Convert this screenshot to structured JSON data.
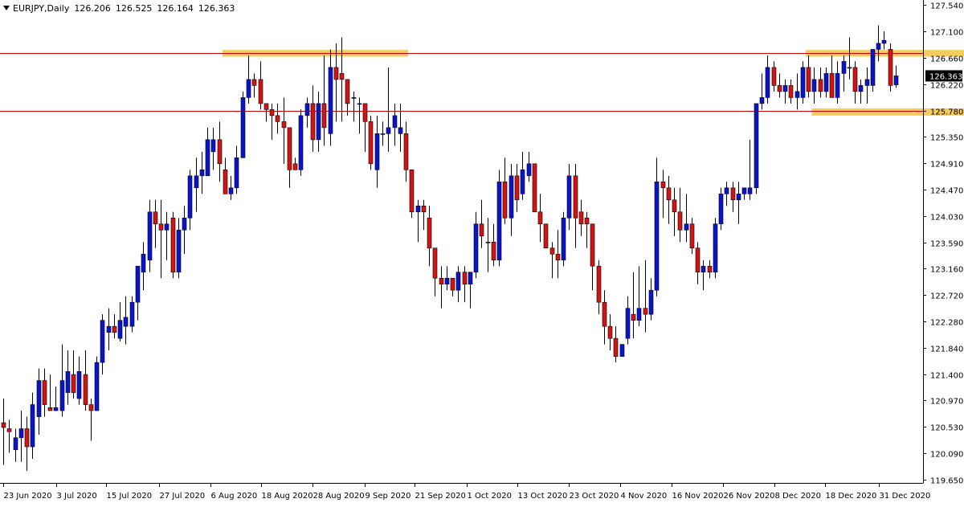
{
  "header": {
    "symbol": "EURJPY,Daily",
    "open": "126.206",
    "high": "126.525",
    "low": "126.164",
    "close": "126.363"
  },
  "current_price_label": "126.363",
  "colors": {
    "bull": "#0a14c8",
    "bear": "#d21414",
    "wick": "#000000",
    "level_line": "#cc0000",
    "zone": "#f3c242",
    "price_badge_bg": "#000000",
    "price_badge_text": "#ffffff"
  },
  "chart_data": {
    "type": "candlestick",
    "title": "",
    "y_ticks": [
      "127.540",
      "127.100",
      "126.660",
      "126.220",
      "125.780",
      "125.350",
      "124.910",
      "124.470",
      "124.030",
      "123.590",
      "123.160",
      "122.720",
      "122.280",
      "121.840",
      "121.400",
      "120.970",
      "120.530",
      "120.090",
      "119.650"
    ],
    "x_ticks": [
      "23 Jun 2020",
      "3 Jul 2020",
      "15 Jul 2020",
      "27 Jul 2020",
      "6 Aug 2020",
      "18 Aug 2020",
      "28 Aug 2020",
      "9 Sep 2020",
      "21 Sep 2020",
      "1 Oct 2020",
      "13 Oct 2020",
      "23 Oct 2020",
      "4 Nov 2020",
      "16 Nov 2020",
      "26 Nov 2020",
      "8 Dec 2020",
      "18 Dec 2020",
      "31 Dec 2020"
    ],
    "ylim": [
      119.6,
      127.62
    ],
    "levels": [
      126.74,
      125.78
    ],
    "zones": [
      {
        "from_bar": 38,
        "to_bar": 69,
        "low": 126.68,
        "high": 126.79
      },
      {
        "from_bar": 138,
        "to_bar": 167,
        "low": 126.68,
        "high": 126.79
      },
      {
        "from_bar": 139,
        "to_bar": 167,
        "low": 125.7,
        "high": 125.82
      }
    ],
    "candles": [
      {
        "o": 120.6,
        "h": 121.0,
        "l": 119.9,
        "c": 120.52
      },
      {
        "o": 120.5,
        "h": 120.65,
        "l": 120.1,
        "c": 120.45
      },
      {
        "o": 120.15,
        "h": 120.5,
        "l": 119.95,
        "c": 120.35
      },
      {
        "o": 120.35,
        "h": 120.8,
        "l": 119.95,
        "c": 120.5
      },
      {
        "o": 120.5,
        "h": 120.7,
        "l": 119.8,
        "c": 120.2
      },
      {
        "o": 120.2,
        "h": 121.1,
        "l": 120.0,
        "c": 120.9
      },
      {
        "o": 120.7,
        "h": 121.5,
        "l": 120.4,
        "c": 121.3
      },
      {
        "o": 121.3,
        "h": 121.5,
        "l": 120.7,
        "c": 120.9
      },
      {
        "o": 120.85,
        "h": 121.4,
        "l": 120.8,
        "c": 120.8
      },
      {
        "o": 120.8,
        "h": 121.2,
        "l": 120.8,
        "c": 120.85
      },
      {
        "o": 120.8,
        "h": 121.9,
        "l": 120.7,
        "c": 121.3
      },
      {
        "o": 121.1,
        "h": 121.8,
        "l": 120.9,
        "c": 121.45
      },
      {
        "o": 121.4,
        "h": 121.8,
        "l": 121.0,
        "c": 121.1
      },
      {
        "o": 121.0,
        "h": 121.7,
        "l": 120.9,
        "c": 121.45
      },
      {
        "o": 121.4,
        "h": 121.8,
        "l": 120.8,
        "c": 120.9
      },
      {
        "o": 120.9,
        "h": 121.0,
        "l": 120.3,
        "c": 120.8
      },
      {
        "o": 120.8,
        "h": 121.7,
        "l": 120.8,
        "c": 121.6
      },
      {
        "o": 121.6,
        "h": 122.4,
        "l": 121.4,
        "c": 122.3
      },
      {
        "o": 122.1,
        "h": 122.5,
        "l": 121.8,
        "c": 122.2
      },
      {
        "o": 122.2,
        "h": 122.4,
        "l": 122.0,
        "c": 122.1
      },
      {
        "o": 122.0,
        "h": 122.6,
        "l": 121.95,
        "c": 122.3
      },
      {
        "o": 122.2,
        "h": 122.7,
        "l": 121.9,
        "c": 122.35
      },
      {
        "o": 122.2,
        "h": 122.7,
        "l": 122.1,
        "c": 122.6
      },
      {
        "o": 122.6,
        "h": 123.2,
        "l": 122.3,
        "c": 123.2
      },
      {
        "o": 123.1,
        "h": 123.6,
        "l": 122.8,
        "c": 123.4
      },
      {
        "o": 123.3,
        "h": 124.3,
        "l": 123.1,
        "c": 124.1
      },
      {
        "o": 124.1,
        "h": 124.3,
        "l": 123.5,
        "c": 123.9
      },
      {
        "o": 123.9,
        "h": 124.3,
        "l": 123.0,
        "c": 123.8
      },
      {
        "o": 123.8,
        "h": 124.1,
        "l": 123.3,
        "c": 123.9
      },
      {
        "o": 124.0,
        "h": 124.1,
        "l": 123.0,
        "c": 123.1
      },
      {
        "o": 123.1,
        "h": 124.0,
        "l": 123.0,
        "c": 123.8
      },
      {
        "o": 123.8,
        "h": 124.2,
        "l": 123.4,
        "c": 124.0
      },
      {
        "o": 124.0,
        "h": 124.8,
        "l": 123.8,
        "c": 124.7
      },
      {
        "o": 124.5,
        "h": 125.0,
        "l": 124.1,
        "c": 124.7
      },
      {
        "o": 124.7,
        "h": 125.1,
        "l": 124.4,
        "c": 124.8
      },
      {
        "o": 124.7,
        "h": 125.5,
        "l": 124.7,
        "c": 125.3
      },
      {
        "o": 125.1,
        "h": 125.5,
        "l": 124.8,
        "c": 125.3
      },
      {
        "o": 125.3,
        "h": 125.6,
        "l": 124.6,
        "c": 124.9
      },
      {
        "o": 124.8,
        "h": 125.0,
        "l": 124.5,
        "c": 124.4
      },
      {
        "o": 124.4,
        "h": 124.7,
        "l": 124.3,
        "c": 124.5
      },
      {
        "o": 124.5,
        "h": 125.2,
        "l": 124.4,
        "c": 125.0
      },
      {
        "o": 125.0,
        "h": 126.1,
        "l": 125.0,
        "c": 126.0
      },
      {
        "o": 126.0,
        "h": 126.7,
        "l": 125.9,
        "c": 126.3
      },
      {
        "o": 126.3,
        "h": 126.4,
        "l": 126.0,
        "c": 126.2
      },
      {
        "o": 126.3,
        "h": 126.6,
        "l": 125.8,
        "c": 125.9
      },
      {
        "o": 125.9,
        "h": 125.9,
        "l": 125.6,
        "c": 125.8
      },
      {
        "o": 125.8,
        "h": 125.9,
        "l": 125.3,
        "c": 125.7
      },
      {
        "o": 125.7,
        "h": 125.9,
        "l": 125.4,
        "c": 125.6
      },
      {
        "o": 125.6,
        "h": 126.0,
        "l": 124.9,
        "c": 125.5
      },
      {
        "o": 125.5,
        "h": 125.5,
        "l": 124.5,
        "c": 124.8
      },
      {
        "o": 124.9,
        "h": 125.0,
        "l": 124.8,
        "c": 124.8
      },
      {
        "o": 124.8,
        "h": 125.8,
        "l": 124.7,
        "c": 125.7
      },
      {
        "o": 125.7,
        "h": 126.0,
        "l": 125.5,
        "c": 125.9
      },
      {
        "o": 125.9,
        "h": 126.2,
        "l": 125.1,
        "c": 125.3
      },
      {
        "o": 125.3,
        "h": 126.1,
        "l": 125.1,
        "c": 125.9
      },
      {
        "o": 125.9,
        "h": 126.7,
        "l": 125.2,
        "c": 125.5
      },
      {
        "o": 125.4,
        "h": 126.8,
        "l": 125.2,
        "c": 126.5
      },
      {
        "o": 126.5,
        "h": 126.9,
        "l": 125.6,
        "c": 126.3
      },
      {
        "o": 126.4,
        "h": 127.0,
        "l": 125.6,
        "c": 126.3
      },
      {
        "o": 126.3,
        "h": 126.3,
        "l": 125.7,
        "c": 125.9
      },
      {
        "o": 126.0,
        "h": 126.1,
        "l": 125.6,
        "c": 126.0
      },
      {
        "o": 125.9,
        "h": 126.0,
        "l": 125.4,
        "c": 125.9
      },
      {
        "o": 125.9,
        "h": 125.9,
        "l": 125.1,
        "c": 125.6
      },
      {
        "o": 125.6,
        "h": 125.7,
        "l": 124.8,
        "c": 124.9
      },
      {
        "o": 124.8,
        "h": 125.7,
        "l": 124.5,
        "c": 125.4
      },
      {
        "o": 125.4,
        "h": 125.6,
        "l": 125.2,
        "c": 125.4
      },
      {
        "o": 125.4,
        "h": 126.5,
        "l": 125.1,
        "c": 125.5
      },
      {
        "o": 125.5,
        "h": 125.9,
        "l": 125.2,
        "c": 125.7
      },
      {
        "o": 125.4,
        "h": 125.9,
        "l": 125.1,
        "c": 125.5
      },
      {
        "o": 125.4,
        "h": 125.6,
        "l": 124.6,
        "c": 124.8
      },
      {
        "o": 124.8,
        "h": 124.8,
        "l": 124.0,
        "c": 124.1
      },
      {
        "o": 124.1,
        "h": 124.3,
        "l": 123.6,
        "c": 124.2
      },
      {
        "o": 124.2,
        "h": 124.3,
        "l": 123.8,
        "c": 124.1
      },
      {
        "o": 124.0,
        "h": 124.2,
        "l": 123.2,
        "c": 123.5
      },
      {
        "o": 123.5,
        "h": 123.5,
        "l": 122.7,
        "c": 123.0
      },
      {
        "o": 123.0,
        "h": 123.2,
        "l": 122.5,
        "c": 122.9
      },
      {
        "o": 122.9,
        "h": 123.2,
        "l": 122.8,
        "c": 123.0
      },
      {
        "o": 123.0,
        "h": 123.0,
        "l": 122.7,
        "c": 122.8
      },
      {
        "o": 122.8,
        "h": 123.2,
        "l": 122.6,
        "c": 123.1
      },
      {
        "o": 123.1,
        "h": 123.2,
        "l": 122.6,
        "c": 122.9
      },
      {
        "o": 122.9,
        "h": 122.9,
        "l": 122.5,
        "c": 123.1
      },
      {
        "o": 123.1,
        "h": 124.1,
        "l": 123.0,
        "c": 123.9
      },
      {
        "o": 123.9,
        "h": 124.3,
        "l": 123.5,
        "c": 123.7
      },
      {
        "o": 123.6,
        "h": 124.0,
        "l": 123.1,
        "c": 123.6
      },
      {
        "o": 123.6,
        "h": 123.9,
        "l": 123.2,
        "c": 123.3
      },
      {
        "o": 123.3,
        "h": 124.8,
        "l": 123.2,
        "c": 124.6
      },
      {
        "o": 124.6,
        "h": 125.0,
        "l": 123.9,
        "c": 124.0
      },
      {
        "o": 124.0,
        "h": 124.9,
        "l": 123.7,
        "c": 124.7
      },
      {
        "o": 124.7,
        "h": 124.9,
        "l": 124.1,
        "c": 124.3
      },
      {
        "o": 124.4,
        "h": 125.1,
        "l": 124.3,
        "c": 124.8
      },
      {
        "o": 124.7,
        "h": 125.1,
        "l": 124.6,
        "c": 124.9
      },
      {
        "o": 124.9,
        "h": 124.9,
        "l": 124.2,
        "c": 124.1
      },
      {
        "o": 124.1,
        "h": 124.4,
        "l": 123.6,
        "c": 123.9
      },
      {
        "o": 123.9,
        "h": 123.9,
        "l": 123.5,
        "c": 123.5
      },
      {
        "o": 123.5,
        "h": 123.6,
        "l": 123.0,
        "c": 123.4
      },
      {
        "o": 123.4,
        "h": 123.8,
        "l": 123.0,
        "c": 123.3
      },
      {
        "o": 123.3,
        "h": 124.1,
        "l": 123.2,
        "c": 124.0
      },
      {
        "o": 124.0,
        "h": 124.9,
        "l": 123.8,
        "c": 124.7
      },
      {
        "o": 124.7,
        "h": 124.9,
        "l": 123.5,
        "c": 124.0
      },
      {
        "o": 124.1,
        "h": 124.3,
        "l": 123.7,
        "c": 123.9
      },
      {
        "o": 124.0,
        "h": 124.1,
        "l": 123.5,
        "c": 123.9
      },
      {
        "o": 123.9,
        "h": 123.9,
        "l": 122.8,
        "c": 123.2
      },
      {
        "o": 123.2,
        "h": 123.3,
        "l": 122.4,
        "c": 122.6
      },
      {
        "o": 122.6,
        "h": 122.8,
        "l": 121.9,
        "c": 122.2
      },
      {
        "o": 122.2,
        "h": 122.4,
        "l": 121.8,
        "c": 122.0
      },
      {
        "o": 122.0,
        "h": 122.2,
        "l": 121.6,
        "c": 121.7
      },
      {
        "o": 121.7,
        "h": 121.9,
        "l": 121.7,
        "c": 121.9
      },
      {
        "o": 122.0,
        "h": 122.7,
        "l": 121.9,
        "c": 122.5
      },
      {
        "o": 122.4,
        "h": 123.1,
        "l": 122.0,
        "c": 122.3
      },
      {
        "o": 122.3,
        "h": 123.2,
        "l": 122.2,
        "c": 122.5
      },
      {
        "o": 122.5,
        "h": 123.3,
        "l": 122.1,
        "c": 122.4
      },
      {
        "o": 122.4,
        "h": 123.0,
        "l": 122.3,
        "c": 122.8
      },
      {
        "o": 122.8,
        "h": 125.0,
        "l": 122.7,
        "c": 124.6
      },
      {
        "o": 124.6,
        "h": 124.8,
        "l": 124.0,
        "c": 124.5
      },
      {
        "o": 124.5,
        "h": 124.7,
        "l": 123.9,
        "c": 124.3
      },
      {
        "o": 124.3,
        "h": 124.5,
        "l": 123.7,
        "c": 124.1
      },
      {
        "o": 124.1,
        "h": 124.5,
        "l": 123.6,
        "c": 123.8
      },
      {
        "o": 123.8,
        "h": 124.4,
        "l": 123.6,
        "c": 123.9
      },
      {
        "o": 123.9,
        "h": 124.0,
        "l": 123.4,
        "c": 123.5
      },
      {
        "o": 123.5,
        "h": 123.6,
        "l": 122.9,
        "c": 123.1
      },
      {
        "o": 123.1,
        "h": 123.3,
        "l": 122.8,
        "c": 123.2
      },
      {
        "o": 123.2,
        "h": 123.3,
        "l": 123.0,
        "c": 123.1
      },
      {
        "o": 123.1,
        "h": 124.0,
        "l": 123.0,
        "c": 123.9
      },
      {
        "o": 123.9,
        "h": 124.5,
        "l": 123.8,
        "c": 124.4
      },
      {
        "o": 124.4,
        "h": 124.6,
        "l": 124.2,
        "c": 124.5
      },
      {
        "o": 124.5,
        "h": 124.6,
        "l": 124.1,
        "c": 124.3
      },
      {
        "o": 124.3,
        "h": 124.6,
        "l": 123.9,
        "c": 124.4
      },
      {
        "o": 124.4,
        "h": 124.5,
        "l": 124.3,
        "c": 124.5
      },
      {
        "o": 124.4,
        "h": 125.3,
        "l": 124.3,
        "c": 124.5
      },
      {
        "o": 124.5,
        "h": 125.9,
        "l": 124.4,
        "c": 125.9
      },
      {
        "o": 125.9,
        "h": 126.4,
        "l": 125.8,
        "c": 126.0
      },
      {
        "o": 126.0,
        "h": 126.7,
        "l": 125.9,
        "c": 126.5
      },
      {
        "o": 126.5,
        "h": 126.6,
        "l": 126.1,
        "c": 126.2
      },
      {
        "o": 126.2,
        "h": 126.4,
        "l": 126.0,
        "c": 126.1
      },
      {
        "o": 126.1,
        "h": 126.3,
        "l": 125.9,
        "c": 126.2
      },
      {
        "o": 126.2,
        "h": 126.3,
        "l": 125.9,
        "c": 126.0
      },
      {
        "o": 126.0,
        "h": 126.4,
        "l": 125.8,
        "c": 126.1
      },
      {
        "o": 126.0,
        "h": 126.6,
        "l": 125.9,
        "c": 126.5
      },
      {
        "o": 126.5,
        "h": 126.7,
        "l": 126.0,
        "c": 126.1
      },
      {
        "o": 126.1,
        "h": 126.5,
        "l": 125.9,
        "c": 126.3
      },
      {
        "o": 126.3,
        "h": 126.5,
        "l": 126.0,
        "c": 126.1
      },
      {
        "o": 126.1,
        "h": 126.5,
        "l": 126.0,
        "c": 126.4
      },
      {
        "o": 126.4,
        "h": 126.7,
        "l": 126.0,
        "c": 126.0
      },
      {
        "o": 126.0,
        "h": 126.6,
        "l": 125.9,
        "c": 126.4
      },
      {
        "o": 126.4,
        "h": 126.7,
        "l": 126.1,
        "c": 126.6
      },
      {
        "o": 126.5,
        "h": 127.0,
        "l": 126.3,
        "c": 126.5
      },
      {
        "o": 126.5,
        "h": 126.6,
        "l": 125.9,
        "c": 126.1
      },
      {
        "o": 126.1,
        "h": 126.3,
        "l": 125.9,
        "c": 126.2
      },
      {
        "o": 126.2,
        "h": 126.5,
        "l": 125.9,
        "c": 126.3
      },
      {
        "o": 126.2,
        "h": 126.8,
        "l": 126.1,
        "c": 126.8
      },
      {
        "o": 126.8,
        "h": 127.2,
        "l": 126.6,
        "c": 126.9
      },
      {
        "o": 126.9,
        "h": 127.1,
        "l": 126.8,
        "c": 126.95
      },
      {
        "o": 126.8,
        "h": 126.9,
        "l": 126.1,
        "c": 126.2
      },
      {
        "o": 126.21,
        "h": 126.53,
        "l": 126.16,
        "c": 126.36
      }
    ]
  }
}
